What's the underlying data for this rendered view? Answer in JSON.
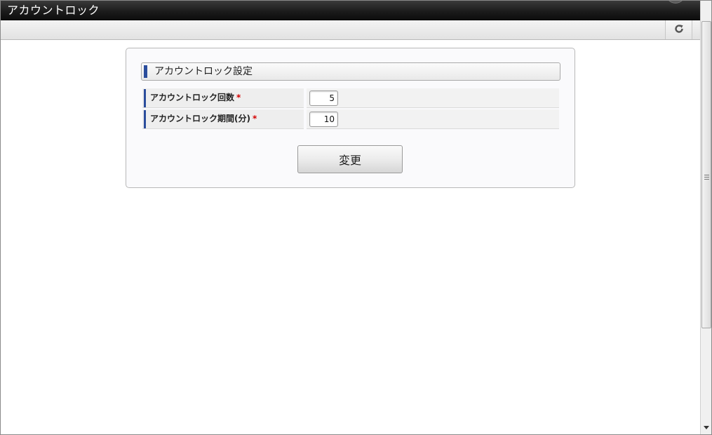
{
  "window": {
    "title": "アカウントロック"
  },
  "toolbar": {
    "refresh_icon": "refresh-icon"
  },
  "section": {
    "title": "アカウントロック設定"
  },
  "form": {
    "required_mark": "*",
    "fields": [
      {
        "label": "アカウントロック回数",
        "value": "5"
      },
      {
        "label": "アカウントロック期間(分)",
        "value": "10"
      }
    ],
    "submit_label": "変更"
  },
  "colors": {
    "accent_bar": "#2b4d9c",
    "required": "#d40000",
    "titlebar": "#1c1c1c"
  }
}
